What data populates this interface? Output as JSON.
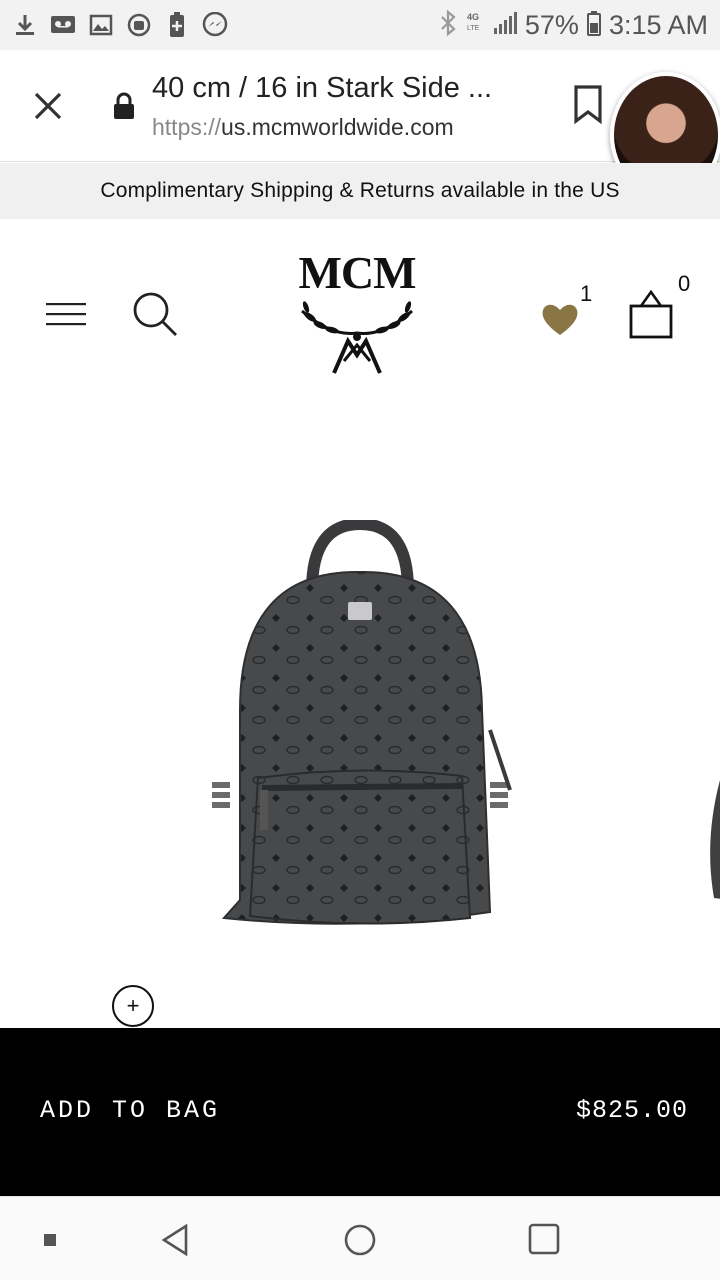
{
  "status_bar": {
    "battery": "57%",
    "time": "3:15 AM",
    "network": "4G LTE",
    "icons": [
      "download-icon",
      "voicemail-icon",
      "image-icon",
      "android-debug-icon",
      "battery-saver-icon",
      "messenger-icon",
      "bluetooth-icon",
      "signal-icon",
      "battery-icon"
    ]
  },
  "browser": {
    "page_title": "40 cm / 16 in Stark Side ...",
    "url_scheme": "https://",
    "url_host": "us.mcmworldwide.com"
  },
  "promo_banner": "Complimentary Shipping & Returns available in the US",
  "header": {
    "logo_text": "MCM",
    "wishlist_count": "1",
    "bag_count": "0"
  },
  "product": {
    "image_alt": "backpack",
    "zoom_label": "+"
  },
  "purchase": {
    "add_label": "ADD TO BAG",
    "price": "$825.00"
  },
  "colors": {
    "accent_gold": "#8a7544",
    "bar_black": "#000000"
  }
}
